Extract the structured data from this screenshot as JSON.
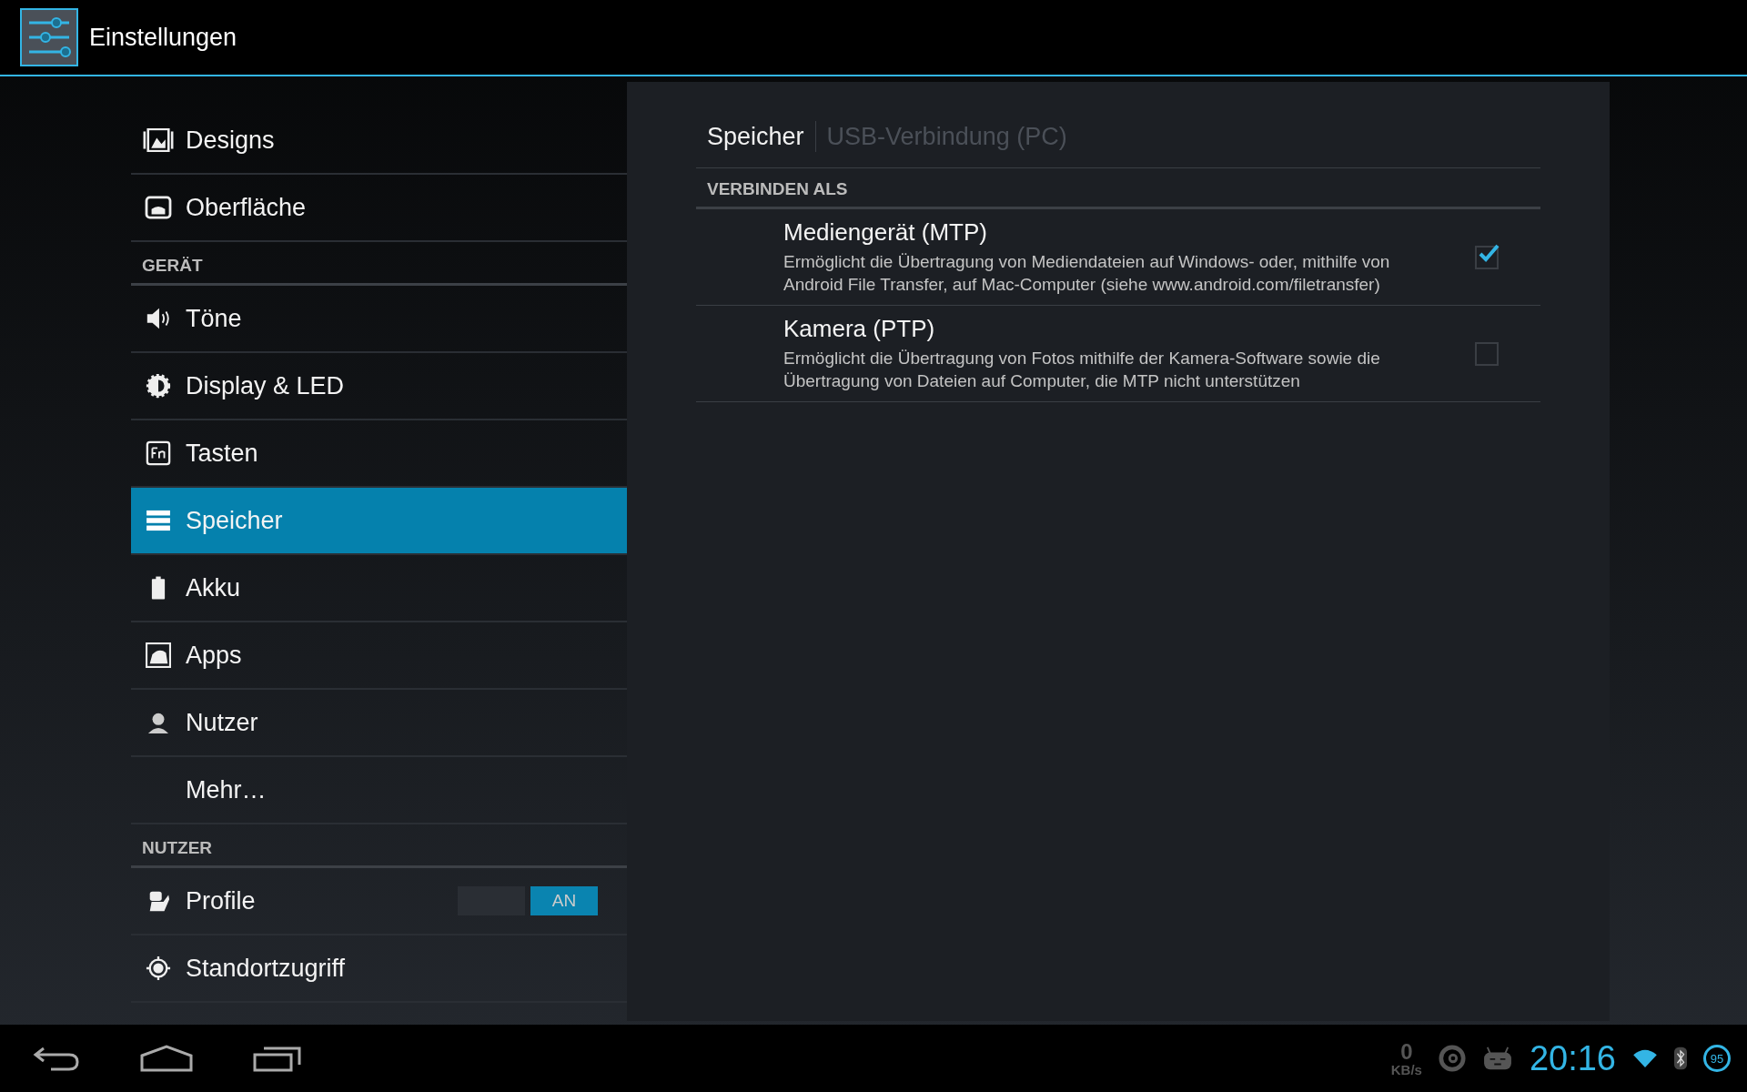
{
  "action_bar": {
    "title": "Einstellungen"
  },
  "sidebar": {
    "items": [
      {
        "kind": "item",
        "label": "Designs",
        "selected": false
      },
      {
        "kind": "item",
        "label": "Oberfläche",
        "selected": false
      },
      {
        "kind": "header",
        "label": "GERÄT"
      },
      {
        "kind": "item",
        "label": "Töne",
        "selected": false
      },
      {
        "kind": "item",
        "label": "Display & LED",
        "selected": false
      },
      {
        "kind": "item",
        "label": "Tasten",
        "selected": false
      },
      {
        "kind": "item",
        "label": "Speicher",
        "selected": true
      },
      {
        "kind": "item",
        "label": "Akku",
        "selected": false
      },
      {
        "kind": "item",
        "label": "Apps",
        "selected": false
      },
      {
        "kind": "item",
        "label": "Nutzer",
        "selected": false
      },
      {
        "kind": "item",
        "label": "Mehr…",
        "selected": false
      },
      {
        "kind": "header",
        "label": "NUTZER"
      },
      {
        "kind": "toggle",
        "label": "Profile",
        "selected": false,
        "on": true,
        "switch_label": "AN"
      },
      {
        "kind": "item",
        "label": "Standortzugriff",
        "selected": false
      }
    ]
  },
  "panel": {
    "breadcrumbs": [
      {
        "label": "Speicher",
        "selected": true
      },
      {
        "label": "USB-Verbindung (PC)",
        "selected": false
      }
    ],
    "section": "VERBINDEN ALS",
    "options": [
      {
        "title": "Mediengerät (MTP)",
        "description": "Ermöglicht die Übertragung von Mediendateien auf Windows- oder, mithilfe von Android File Transfer, auf Mac-Computer (siehe www.android.com/filetransfer)",
        "checked": true
      },
      {
        "title": "Kamera (PTP)",
        "description": "Ermöglicht die Übertragung von Fotos mithilfe der Kamera-Software sowie die Übertragung von Dateien auf Computer, die MTP nicht unterstützen",
        "checked": false
      }
    ]
  },
  "system_bar": {
    "speed": "0",
    "speed_unit": "KB/s",
    "time": "20:16",
    "battery": "95"
  }
}
